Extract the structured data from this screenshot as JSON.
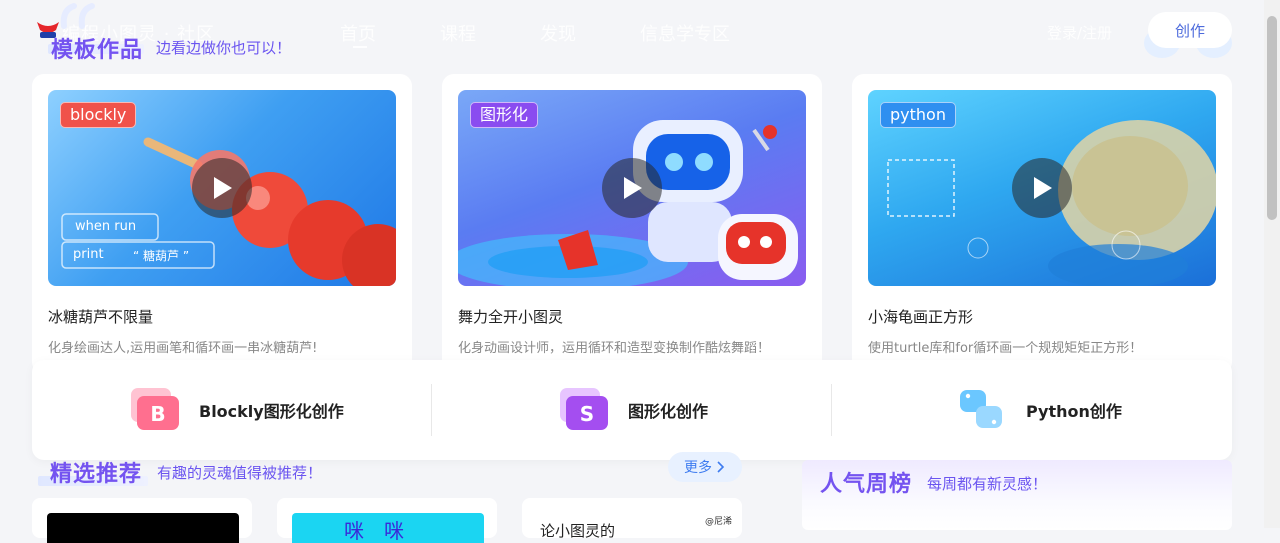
{
  "nav": {
    "brand": "编程小图灵 · 社区",
    "links": [
      "首页",
      "课程",
      "发现",
      "信息学专区"
    ],
    "login": "登录/注册",
    "create": "创作"
  },
  "templates": {
    "title": "模板作品",
    "subtitle": "边看边做你也可以！",
    "cards": [
      {
        "tag": "blockly",
        "tag_color": "#f0524a",
        "title": "冰糖葫芦不限量",
        "desc": "化身绘画达人,运用画笔和循环画一串冰糖葫芦!",
        "code_line1": "when run",
        "code_line2": "print",
        "code_str": "“ 糖葫芦 ”"
      },
      {
        "tag": "图形化",
        "tag_color": "#8a4cf0",
        "title": "舞力全开小图灵",
        "desc": "化身动画设计师，运用循环和造型变换制作酷炫舞蹈！"
      },
      {
        "tag": "python",
        "tag_color": "#2f8ff0",
        "title": "小海龟画正方形",
        "desc": "使用turtle库和for循环画一个规规矩矩正方形！"
      }
    ]
  },
  "creation": [
    {
      "icon_letter": "B",
      "label": "Blockly图形化创作"
    },
    {
      "icon_letter": "S",
      "label": "图形化创作"
    },
    {
      "icon_letter": "",
      "label": "Python创作"
    }
  ],
  "featured": {
    "title": "精选推荐",
    "subtitle": "有趣的灵魂值得被推荐！",
    "more": "更多",
    "card_snippets": [
      "",
      "咪　咪",
      "论小图灵的",
      "@尼浠"
    ]
  },
  "ranking": {
    "title": "人气周榜",
    "subtitle": "每周都有新灵感！"
  }
}
